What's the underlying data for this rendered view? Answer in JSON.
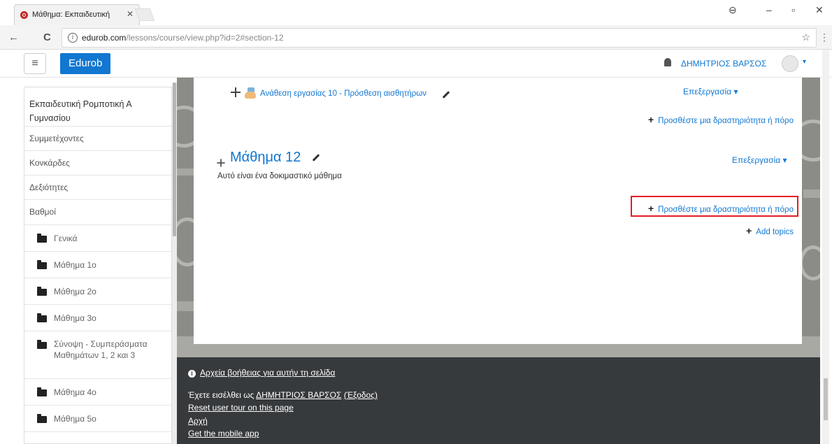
{
  "browser": {
    "tab_title": "Μάθημα: Εκπαιδευτική",
    "tab_close": "✕",
    "url_host": "edurob.com",
    "url_path": "/lessons/course/view.php?id=2#section-12",
    "back": "←",
    "reload": "C",
    "star": "☆",
    "menu": "⋮",
    "minimize": "–",
    "restore": "▫",
    "close": "✕",
    "profile": "⊖"
  },
  "navbar": {
    "menu_toggle": "≡",
    "brand": "Edurob",
    "username": "ΔΗΜΗΤΡΙΟΣ ΒΑΡΣΟΣ",
    "caret": "▾"
  },
  "sidebar": {
    "course_title": "Εκπαιδευτική Ρομποτική Α Γυμνασίου",
    "links": [
      "Συμμετέχοντες",
      "Κονκάρδες",
      "Δεξιότητες",
      "Βαθμοί"
    ],
    "sections": [
      "Γενικά",
      "Μάθημα 1ο",
      "Μάθημα 2ο",
      "Μάθημα 3ο",
      "Σύνοψη - Συμπεράσματα Μαθημάτων 1, 2 και 3",
      "Μάθημα 4ο",
      "Μάθημα 5ο"
    ]
  },
  "main": {
    "activity_link": "Ανάθεση εργασίας 10 - Πρόσθεση αισθητήρων",
    "edit_label": "Επεξεργασία",
    "edit_caret": "▾",
    "add_activity": "Προσθέστε μια δραστηριότητα ή πόρο",
    "section_title": "Μάθημα 12",
    "section_description": "Αυτό είναι ένα δοκιμαστικό μάθημα",
    "add_topics": "Add topics",
    "checkbox": "☑"
  },
  "footer": {
    "help_link": "Αρχεία βοήθειας για αυτήν τη σελίδα",
    "logged_in_prefix": "Έχετε εισέλθει ως ",
    "logged_in_user": "ΔΗΜΗΤΡΙΟΣ ΒΑΡΣΟΣ",
    "logout": "(Έξοδος)",
    "reset_tour": "Reset user tour on this page",
    "home": "Αρχή",
    "mobile_app": "Get the mobile app"
  },
  "colors": {
    "link": "#1177d1",
    "brand": "#1177d1",
    "footer_bg": "#373a3c",
    "highlight": "#e41e26"
  }
}
